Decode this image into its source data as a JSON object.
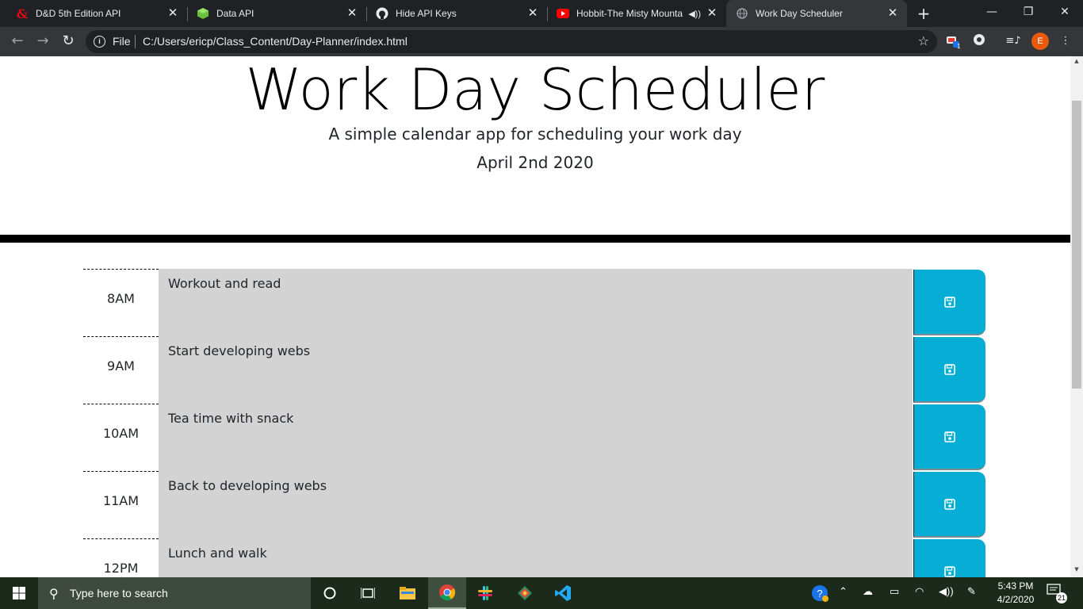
{
  "browser": {
    "tabs": [
      {
        "title": "D&D 5th Edition API",
        "icon": "dnd-ampersand-icon"
      },
      {
        "title": "Data API",
        "icon": "cube-icon"
      },
      {
        "title": "Hide API Keys",
        "icon": "github-icon"
      },
      {
        "title": "Hobbit-The Misty Mounta",
        "icon": "youtube-icon",
        "audio": "speaker-icon"
      },
      {
        "title": "Work Day Scheduler",
        "icon": "globe-icon",
        "active": true
      }
    ],
    "address": {
      "scheme_label": "File",
      "url": "C:/Users/ericp/Class_Content/Day-Planner/index.html"
    },
    "profile_initial": "E",
    "extension_badge": "1"
  },
  "header": {
    "title": "Work Day Scheduler",
    "lead": "A simple calendar app for scheduling your work day",
    "current_day": "April 2nd 2020"
  },
  "schedule": [
    {
      "hour": "8AM",
      "description": "Workout and read"
    },
    {
      "hour": "9AM",
      "description": "Start developing webs"
    },
    {
      "hour": "10AM",
      "description": "Tea time with snack"
    },
    {
      "hour": "11AM",
      "description": "Back to developing webs"
    },
    {
      "hour": "12PM",
      "description": "Lunch and walk"
    }
  ],
  "colors": {
    "past": "#d3d3d3",
    "save_button": "#06aed5",
    "header_border": "#000000"
  },
  "taskbar": {
    "search_placeholder": "Type here to search",
    "time": "5:43 PM",
    "date": "4/2/2020",
    "notification_count": "21"
  }
}
